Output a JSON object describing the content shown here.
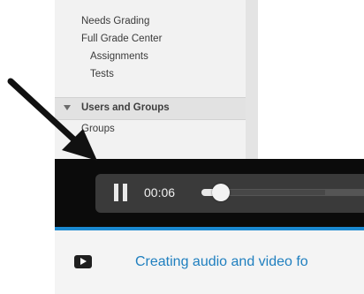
{
  "sidebar": {
    "items": [
      {
        "label": "Needs Grading"
      },
      {
        "label": "Full Grade Center"
      },
      {
        "label": "Assignments"
      },
      {
        "label": "Tests"
      }
    ],
    "section": {
      "label": "Users and Groups",
      "items": [
        {
          "label": "Groups"
        }
      ]
    }
  },
  "player": {
    "time": "00:06",
    "progress": 0.12,
    "play_state_icon": "pause-icon"
  },
  "video": {
    "title": "Creating audio and video fo",
    "icon": "video-play-icon"
  },
  "colors": {
    "accent": "#1b8ad1",
    "link": "#1f7fbf",
    "player_bg": "#0b0b0b"
  }
}
